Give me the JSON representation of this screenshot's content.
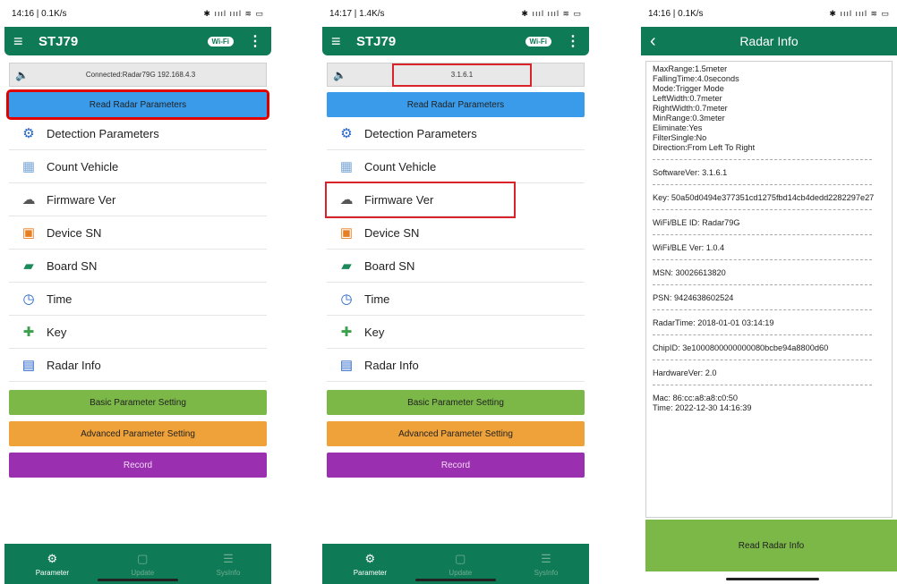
{
  "screens": [
    {
      "status_time": "14:16 | 0.1K/s",
      "status_icons": "✱ ıııl ıııl ≋ ▭",
      "app_title": "STJ79",
      "wifi_badge": "Wi-Fi",
      "connection_text": "Connected:Radar79G 192.168.4.3",
      "read_button": "Read Radar Parameters",
      "menu": [
        "Detection Parameters",
        "Count Vehicle",
        "Firmware Ver",
        "Device SN",
        "Board SN",
        "Time",
        "Key",
        "Radar Info"
      ],
      "basic_button": "Basic Parameter Setting",
      "advanced_button": "Advanced Parameter Setting",
      "record_button": "Record",
      "tabs": [
        "Parameter",
        "Update",
        "SysInfo"
      ]
    },
    {
      "status_time": "14:17 | 1.4K/s",
      "status_icons": "✱ ıııl ıııl ≋ ▭",
      "app_title": "STJ79",
      "wifi_badge": "Wi-Fi",
      "connection_text": "3.1.6.1",
      "read_button": "Read Radar Parameters",
      "menu": [
        "Detection Parameters",
        "Count Vehicle",
        "Firmware Ver",
        "Device SN",
        "Board SN",
        "Time",
        "Key",
        "Radar Info"
      ],
      "basic_button": "Basic Parameter Setting",
      "advanced_button": "Advanced Parameter Setting",
      "record_button": "Record",
      "tabs": [
        "Parameter",
        "Update",
        "SysInfo"
      ]
    },
    {
      "status_time": "14:16 | 0.1K/s",
      "status_icons": "✱ ıııl ıııl ≋ ▭",
      "title": "Radar Info",
      "params": [
        "MaxRange:1.5meter",
        "FallingTime:4.0seconds",
        "Mode:Trigger Mode",
        "LeftWidth:0.7meter",
        "RightWidth:0.7meter",
        "MinRange:0.3meter",
        "Eliminate:Yes",
        "FilterSingle:No",
        "Direction:From Left To Right"
      ],
      "software_ver": "SoftwareVer: 3.1.6.1",
      "key": "Key: 50a50d0494e377351cd1275fbd14cb4dedd2282297e27",
      "wifi_id": "WiFi/BLE ID: Radar79G",
      "wifi_ver": "WiFi/BLE Ver: 1.0.4",
      "msn": "MSN: 30026613820",
      "psn": "PSN: 9424638602524",
      "radar_time": "RadarTime: 2018-01-01 03:14:19",
      "chip_id": "ChipID: 3e1000800000000080bcbe94a8800d60",
      "hardware_ver": "HardwareVer: 2.0",
      "mac": "Mac: 86:cc:a8:a8:c0:50",
      "time": "Time: 2022-12-30 14:16:39",
      "read_button": "Read Radar Info"
    }
  ],
  "icons": {
    "menu": [
      "gear-icon",
      "car-icon",
      "cloud-icon",
      "qr-icon",
      "board-icon",
      "clock-icon",
      "key-icon",
      "monitor-icon"
    ],
    "colors": {
      "primary": "#0f7a56",
      "blue": "#3a9bea",
      "green": "#7bb848",
      "orange": "#f0a23a",
      "purple": "#9a2fb0",
      "highlight": "#d8232a"
    }
  }
}
